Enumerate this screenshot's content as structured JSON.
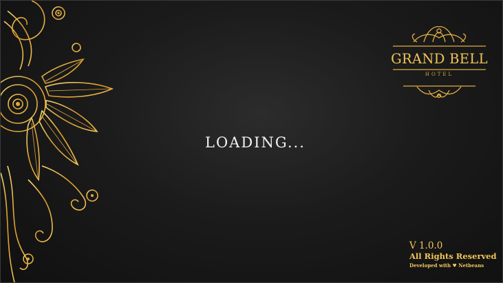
{
  "app": {
    "loading": "LOADING...",
    "brand": {
      "name": "GRAND BELL",
      "subtitle": "HOTEL"
    },
    "footer": {
      "version": "V 1.0.0",
      "rights": "All Rights Reserved",
      "developed_prefix": "Developed with",
      "heart_icon": "heart-icon",
      "developed_suffix": "Netbeans"
    }
  },
  "colors": {
    "background": "#161616",
    "gold": "#f0c558",
    "text": "#f2f2f2"
  }
}
